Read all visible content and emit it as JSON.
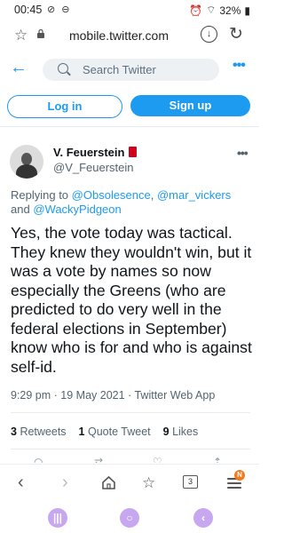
{
  "status_bar": {
    "time": "00:45",
    "battery": "32%"
  },
  "browser": {
    "url": "mobile.twitter.com"
  },
  "twitter_header": {
    "search_placeholder": "Search Twitter",
    "more": "•••"
  },
  "auth": {
    "login": "Log in",
    "signup": "Sign up"
  },
  "tweet": {
    "author_name": "V. Feuerstein",
    "author_handle": "@V_Feuerstein",
    "replying_to_prefix": "Replying to",
    "mention1": "@Obsolesence",
    "mention2": "@mar_vickers",
    "and": "and",
    "mention3": "@WackyPidgeon",
    "text": "Yes, the vote today was tactical. They knew they wouldn't win, but it was a vote by names so now especially the Greens (who are predicted to do very well in the federal elections in September) know who is for and who is against self-id.",
    "time": "9:29 pm",
    "date": "19 May 2021",
    "source": "Twitter Web App",
    "retweets_count": "3",
    "retweets_label": "Retweets",
    "quotes_count": "1",
    "quotes_label": "Quote Tweet",
    "likes_count": "9",
    "likes_label": "Likes"
  },
  "bottom_nav": {
    "tab_count": "3",
    "badge": "N"
  },
  "colors": {
    "accent": "#1d9bf0",
    "text": "#0f1419",
    "muted": "#536471",
    "nav_purple": "#c7a7ef"
  }
}
